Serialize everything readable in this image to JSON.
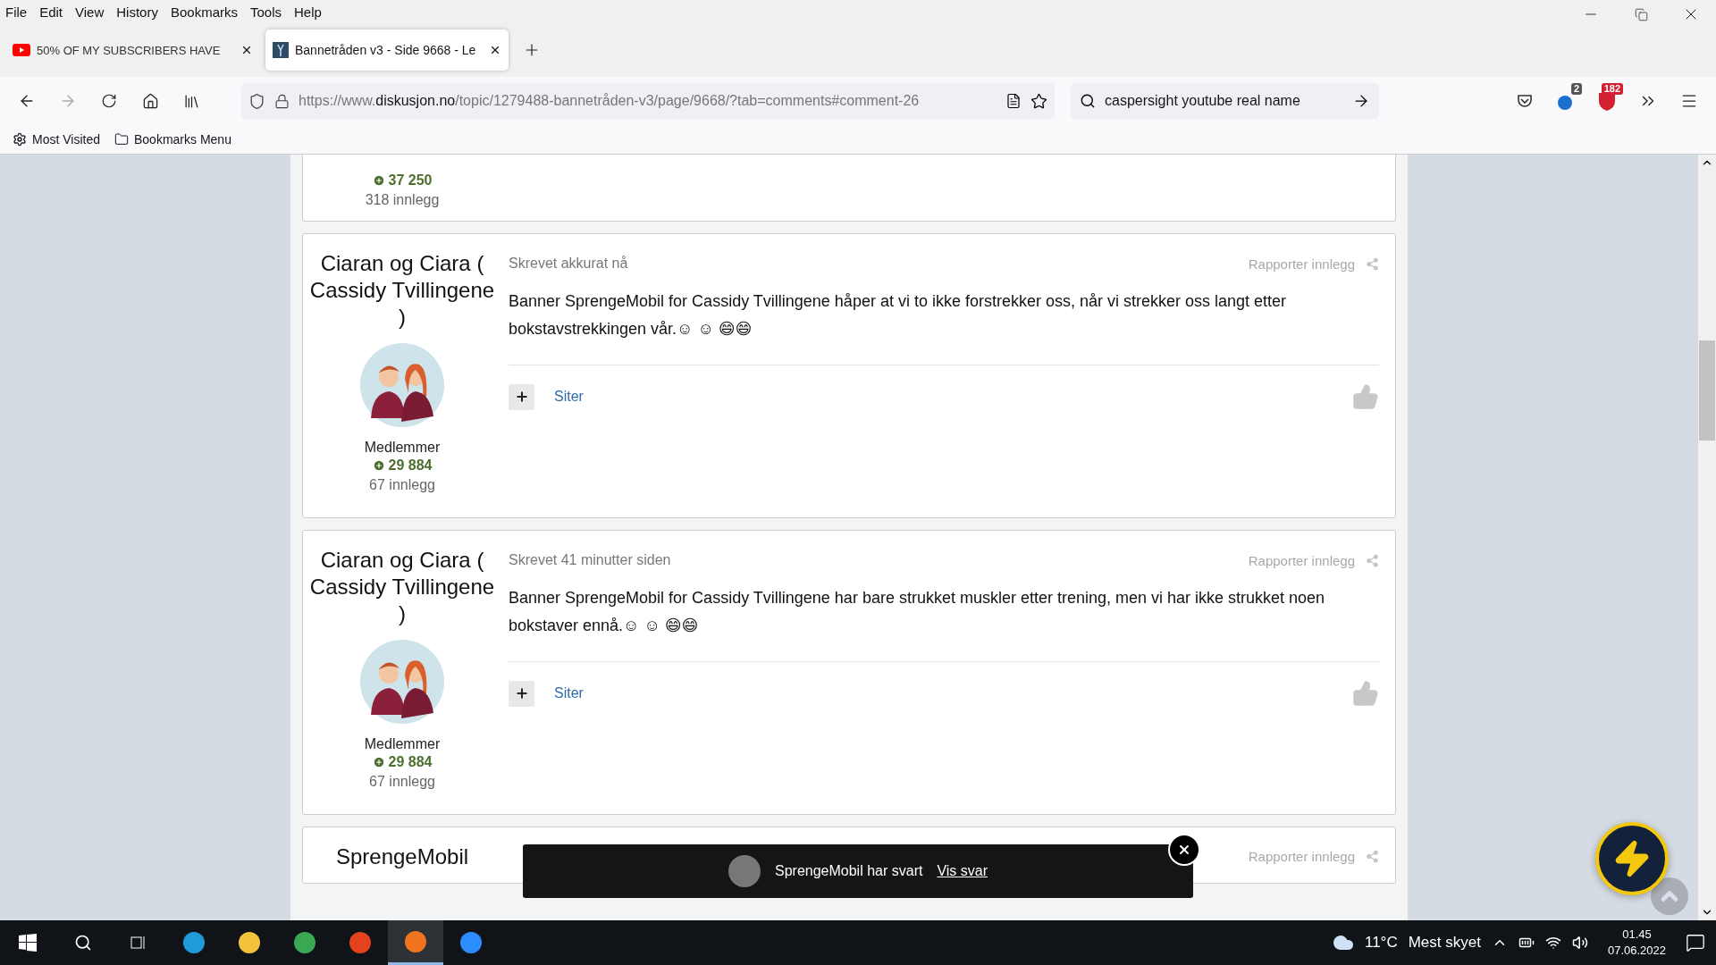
{
  "menu_bar": [
    "File",
    "Edit",
    "View",
    "History",
    "Bookmarks",
    "Tools",
    "Help"
  ],
  "tabs": [
    {
      "title": "50% OF MY SUBSCRIBERS HAVE",
      "selected": false
    },
    {
      "title": "Bannetråden v3 - Side 9668 - Le",
      "selected": true
    }
  ],
  "address_bar": {
    "url_prefix": "https://www.",
    "url_domain": "diskusjon.no",
    "url_path": "/topic/1279488-bannetråden-v3/page/9668/?tab=comments#comment-26"
  },
  "search_bar": {
    "value": "caspersight youtube real name"
  },
  "toolbar_badges": [
    "2",
    "182"
  ],
  "bookmarks": [
    "Most Visited",
    "Bookmarks Menu"
  ],
  "previous_post": {
    "reputation": "37 250",
    "post_count": "318 innlegg"
  },
  "posts": [
    {
      "author": "Ciaran og Ciara ( Cassidy Tvillingene )",
      "role": "Medlemmer",
      "reputation": "29 884",
      "post_count": "67 innlegg",
      "timestamp": "Skrevet akkurat nå",
      "report_label": "Rapporter innlegg",
      "body": "Banner SprengeMobil for Cassidy Tvillingene håper at vi to ikke forstrekker oss, når vi strekker oss langt etter bokstavstrekkingen vår.☺  ☺  😄😄",
      "quote_label": "Siter"
    },
    {
      "author": "Ciaran og Ciara ( Cassidy Tvillingene )",
      "role": "Medlemmer",
      "reputation": "29 884",
      "post_count": "67 innlegg",
      "timestamp": "Skrevet 41 minutter siden",
      "report_label": "Rapporter innlegg",
      "body": "Banner SprengeMobil for Cassidy Tvillingene har bare strukket muskler etter trening, men vi har ikke strukket noen bokstaver ennå.☺  ☺  😄😄",
      "quote_label": "Siter"
    },
    {
      "author": "SprengeMobil",
      "report_label": "Rapporter innlegg"
    }
  ],
  "toast": {
    "text": "SprengeMobil har svart",
    "link": "Vis svar"
  },
  "taskbar": {
    "temperature": "11°C",
    "weather": "Mest skyet",
    "time": "01.45",
    "date": "07.06.2022"
  }
}
